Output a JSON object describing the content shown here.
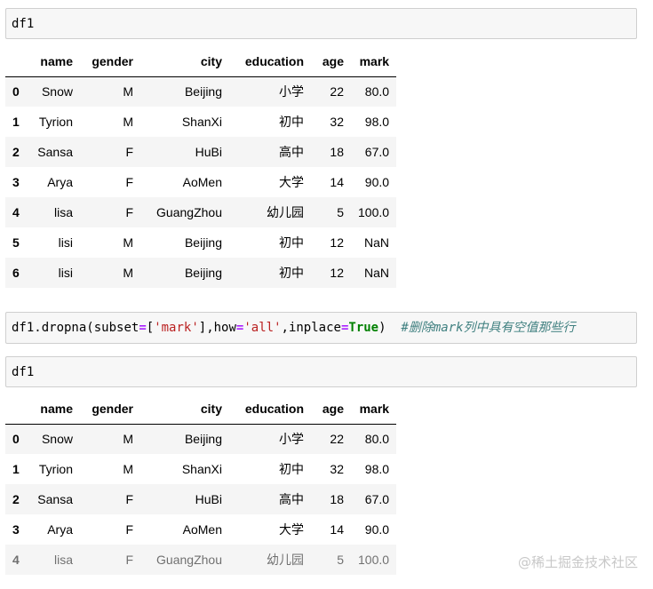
{
  "cells": [
    {
      "code": "df1"
    },
    {
      "tokens": [
        {
          "t": "df1.",
          "c": "fn"
        },
        {
          "t": "dropna",
          "c": "fn"
        },
        {
          "t": "(subset",
          "c": "fn"
        },
        {
          "t": "=",
          "c": "op"
        },
        {
          "t": "[",
          "c": "fn"
        },
        {
          "t": "'mark'",
          "c": "str"
        },
        {
          "t": "],how",
          "c": "fn"
        },
        {
          "t": "=",
          "c": "op"
        },
        {
          "t": "'all'",
          "c": "str"
        },
        {
          "t": ",inplace",
          "c": "fn"
        },
        {
          "t": "=",
          "c": "op"
        },
        {
          "t": "True",
          "c": "kw"
        },
        {
          "t": ")  ",
          "c": "fn"
        },
        {
          "t": "#删除mark列中具有空值那些行",
          "c": "cmt"
        }
      ]
    },
    {
      "code": "df1"
    }
  ],
  "table_columns": [
    "",
    "name",
    "gender",
    "city",
    "education",
    "age",
    "mark"
  ],
  "table1": {
    "rows": [
      [
        "0",
        "Snow",
        "M",
        "Beijing",
        "小学",
        "22",
        "80.0"
      ],
      [
        "1",
        "Tyrion",
        "M",
        "ShanXi",
        "初中",
        "32",
        "98.0"
      ],
      [
        "2",
        "Sansa",
        "F",
        "HuBi",
        "高中",
        "18",
        "67.0"
      ],
      [
        "3",
        "Arya",
        "F",
        "AoMen",
        "大学",
        "14",
        "90.0"
      ],
      [
        "4",
        "lisa",
        "F",
        "GuangZhou",
        "幼儿园",
        "5",
        "100.0"
      ],
      [
        "5",
        "lisi",
        "M",
        "Beijing",
        "初中",
        "12",
        "NaN"
      ],
      [
        "6",
        "lisi",
        "M",
        "Beijing",
        "初中",
        "12",
        "NaN"
      ]
    ]
  },
  "table2": {
    "rows": [
      [
        "0",
        "Snow",
        "M",
        "Beijing",
        "小学",
        "22",
        "80.0"
      ],
      [
        "1",
        "Tyrion",
        "M",
        "ShanXi",
        "初中",
        "32",
        "98.0"
      ],
      [
        "2",
        "Sansa",
        "F",
        "HuBi",
        "高中",
        "18",
        "67.0"
      ],
      [
        "3",
        "Arya",
        "F",
        "AoMen",
        "大学",
        "14",
        "90.0"
      ],
      [
        "4",
        "lisa",
        "F",
        "GuangZhou",
        "幼儿园",
        "5",
        "100.0"
      ]
    ]
  },
  "watermark": "@稀土掘金技术社区"
}
